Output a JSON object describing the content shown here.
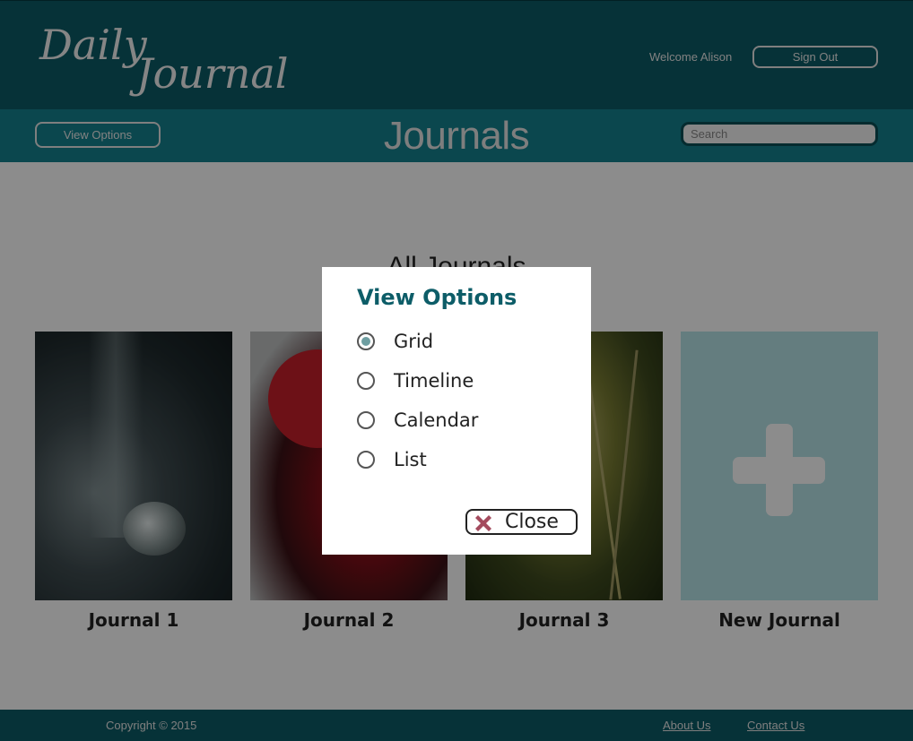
{
  "header": {
    "logo_line1": "Daily",
    "logo_line2": "Journal",
    "welcome": "Welcome Alison",
    "signout_label": "Sign Out"
  },
  "subbar": {
    "view_options_label": "View Options",
    "title": "Journals",
    "search_placeholder": "Search"
  },
  "main": {
    "title": "All Journals",
    "cards": [
      {
        "label": "Journal 1"
      },
      {
        "label": "Journal 2"
      },
      {
        "label": "Journal 3"
      },
      {
        "label": "New Journal"
      }
    ]
  },
  "modal": {
    "title": "View Options",
    "options": [
      {
        "label": "Grid",
        "checked": true
      },
      {
        "label": "Timeline",
        "checked": false
      },
      {
        "label": "Calendar",
        "checked": false
      },
      {
        "label": "List",
        "checked": false
      }
    ],
    "close_label": "Close",
    "close_icon_color": "#a44b5e"
  },
  "footer": {
    "copyright": "Copyright © 2015",
    "about": "About Us",
    "contact": "Contact Us"
  },
  "colors": {
    "header_bg": "#0c5b66",
    "subbar_bg": "#15828e",
    "accent_title": "#0d5d68",
    "new_journal_tile": "#b6e4e7"
  }
}
